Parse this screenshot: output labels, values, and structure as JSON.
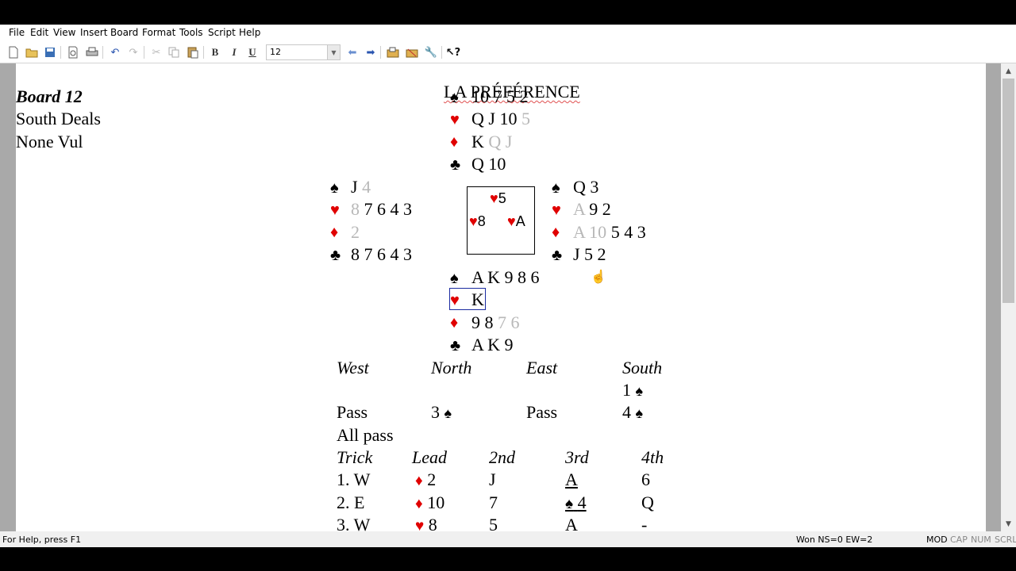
{
  "menu": [
    "File",
    "Edit",
    "View",
    "Insert",
    "Board",
    "Format",
    "Tools",
    "Script",
    "Help"
  ],
  "toolbar": {
    "font_size": "12",
    "bold": "B",
    "italic": "I",
    "underline": "U"
  },
  "document": {
    "title": "LA PRÉFÉRENCE",
    "board": "Board 12",
    "dealer": "South Deals",
    "vulnerability": "None Vul"
  },
  "hands": {
    "north": {
      "spades": "10 7 5 2",
      "hearts_played": "Q J 10",
      "hearts_gray": "5",
      "diamonds_played": "K",
      "diamonds_gray": "Q J",
      "clubs": "Q 10"
    },
    "west": {
      "spades_played": "J",
      "spades_gray": "4",
      "hearts_gray": "8",
      "hearts_played": "7 6 4 3",
      "diamonds_gray": "2",
      "clubs": "8 7 6 4 3"
    },
    "east": {
      "spades": "Q 3",
      "hearts_gray": "A",
      "hearts_played": "9 2",
      "diamonds_gray": "A 10",
      "diamonds_played": "5 4 3",
      "clubs": "J 5 2"
    },
    "south": {
      "spades": "A K 9 8 6",
      "hearts": "K",
      "diamonds_played": "9 8",
      "diamonds_gray": "7 6",
      "clubs": "A K 9"
    }
  },
  "trick_cards": {
    "north": "5",
    "west": "8",
    "east": "A"
  },
  "auction": {
    "headers": [
      "West",
      "North",
      "East",
      "South"
    ],
    "row1": {
      "south": "1"
    },
    "row2": {
      "west": "Pass",
      "north": "3",
      "east": "Pass",
      "south": "4"
    },
    "row3": "All pass"
  },
  "play": {
    "headers": [
      "Trick",
      "Lead",
      "2nd",
      "3rd",
      "4th"
    ],
    "rows": [
      {
        "trick": "1. W",
        "lead": "2",
        "second": "J",
        "third": "A",
        "fourth": "6"
      },
      {
        "trick": "2. E",
        "lead": "10",
        "second": "7",
        "third": "4",
        "fourth": "Q"
      },
      {
        "trick": "3. W",
        "lead": "8",
        "second": "5",
        "third": "A",
        "fourth": "-"
      }
    ]
  },
  "status": {
    "help": "For Help, press F1",
    "score": "Won NS=0 EW=2",
    "indicators": [
      "MOD",
      "CAP",
      "NUM",
      "SCRL"
    ]
  },
  "icons": {
    "spade": "♠",
    "heart": "♥",
    "diamond": "♦",
    "club": "♣"
  },
  "colors": {
    "red_suit": "#e00000",
    "selection": "#1a2aa0"
  }
}
